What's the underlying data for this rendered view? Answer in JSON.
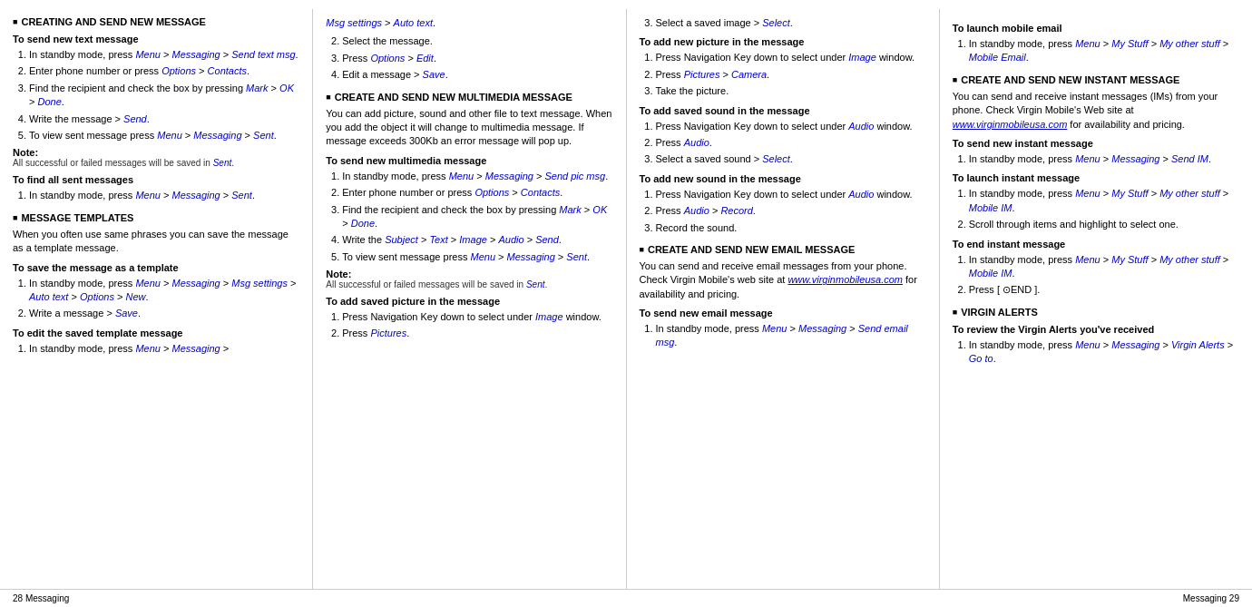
{
  "footer": {
    "left": "28   Messaging",
    "right": "Messaging   29"
  },
  "columns": [
    {
      "id": "col1",
      "sections": [
        {
          "type": "section",
          "title": "CREATING AND SEND NEW MESSAGE",
          "subsections": [
            {
              "type": "subsection",
              "title": "To send new text message",
              "items": [
                {
                  "num": 1,
                  "text": "In standby mode, press ",
                  "links": [
                    "Menu",
                    "Messaging",
                    "Send text msg"
                  ],
                  "separators": [
                    " > ",
                    " > "
                  ]
                },
                {
                  "num": 2,
                  "text": "Enter phone number or press ",
                  "links": [
                    "Options",
                    "Contacts"
                  ],
                  "separators": [
                    " > "
                  ]
                },
                {
                  "num": 3,
                  "text": "Find the recipient and check the box by pressing ",
                  "links": [
                    "Mark",
                    "OK",
                    "Done"
                  ],
                  "separators": [
                    " > ",
                    " > "
                  ]
                },
                {
                  "num": 4,
                  "text": "Write the message > ",
                  "links": [
                    "Send"
                  ]
                },
                {
                  "num": 5,
                  "text": "To view sent message press ",
                  "links": [
                    "Menu",
                    "Messaging",
                    "Sent"
                  ],
                  "separators": [
                    " > ",
                    " > "
                  ]
                }
              ],
              "note": {
                "label": "Note:",
                "text": "All successful or failed messages will be saved in Sent."
              }
            },
            {
              "type": "subsection",
              "title": "To find all sent messages",
              "items": [
                {
                  "num": 1,
                  "text": "In standby mode, press ",
                  "links": [
                    "Menu",
                    "Messaging",
                    "Sent"
                  ],
                  "separators": [
                    " > ",
                    " > "
                  ]
                }
              ]
            }
          ]
        },
        {
          "type": "section",
          "title": "MESSAGE TEMPLATES",
          "desc": "When you often use same phrases you can save the message as a template message.",
          "subsections": [
            {
              "type": "subsection",
              "title": "To save the message as a template",
              "items": [
                {
                  "num": 1,
                  "text": "In standby mode, press ",
                  "links": [
                    "Menu",
                    "Messaging",
                    "Msg settings",
                    "Auto text",
                    "Options",
                    "New"
                  ],
                  "separators": [
                    " > ",
                    " > ",
                    " > ",
                    " > ",
                    " > "
                  ]
                },
                {
                  "num": 2,
                  "text": "Write a message > ",
                  "links": [
                    "Save"
                  ]
                }
              ]
            },
            {
              "type": "subsection",
              "title": "To edit the saved template message",
              "items": [
                {
                  "num": 1,
                  "text": "In standby mode, press ",
                  "links": [
                    "Menu",
                    "Messaging"
                  ],
                  "separators": [
                    " > "
                  ],
                  "suffix": " > "
                }
              ]
            }
          ]
        }
      ]
    },
    {
      "id": "col2",
      "sections": [
        {
          "type": "continuation",
          "prefix_links": [
            "Msg settings",
            "Auto text"
          ],
          "prefix_separators": [
            " > "
          ],
          "subsections": [
            {
              "items_plain": [
                {
                  "num": 2,
                  "text": "Select the message."
                },
                {
                  "num": 3,
                  "text": "Press ",
                  "links": [
                    "Options",
                    "Edit"
                  ],
                  "separators": [
                    " > "
                  ]
                },
                {
                  "num": 4,
                  "text": "Edit a message > ",
                  "links": [
                    "Save"
                  ]
                }
              ]
            }
          ]
        },
        {
          "type": "section",
          "title": "CREATE AND SEND NEW MULTIMEDIA MESSAGE",
          "desc": "You can add picture, sound and other file to text message. When you add the object it will change to multimedia message. If message exceeds 300Kb an error message will pop up.",
          "subsections": [
            {
              "type": "subsection",
              "title": "To send new multimedia message",
              "items": [
                {
                  "num": 1,
                  "text": "In standby mode, press ",
                  "links": [
                    "Menu",
                    "Messaging",
                    "Send pic msg"
                  ],
                  "separators": [
                    " > ",
                    " > "
                  ]
                },
                {
                  "num": 2,
                  "text": "Enter phone number or press ",
                  "links": [
                    "Options",
                    "Contacts"
                  ],
                  "separators": [
                    " > "
                  ]
                },
                {
                  "num": 3,
                  "text": "Find the recipient and check the box by pressing ",
                  "links": [
                    "Mark",
                    "OK",
                    "Done"
                  ],
                  "separators": [
                    " > ",
                    " > "
                  ]
                },
                {
                  "num": 4,
                  "text": "Write the ",
                  "links": [
                    "Subject",
                    "Text",
                    "Image",
                    "Audio",
                    "Send"
                  ],
                  "separators": [
                    " > ",
                    " > ",
                    " > ",
                    " > "
                  ]
                },
                {
                  "num": 5,
                  "text": "To view sent message press ",
                  "links": [
                    "Menu",
                    "Messaging",
                    "Sent"
                  ],
                  "separators": [
                    " > ",
                    " > "
                  ]
                }
              ],
              "note": {
                "label": "Note:",
                "text": "All successful or failed messages will be saved in Sent."
              }
            },
            {
              "type": "subsection",
              "title": "To add saved picture in the message",
              "items": [
                {
                  "num": 1,
                  "text": "Press Navigation Key down to select under ",
                  "links": [
                    "Image"
                  ],
                  "suffix": " window."
                },
                {
                  "num": 2,
                  "text": "Press ",
                  "links": [
                    "Pictures"
                  ]
                }
              ]
            }
          ]
        }
      ]
    },
    {
      "id": "col3",
      "sections": [
        {
          "type": "continuation2",
          "items_plain": [
            {
              "num": 3,
              "text": "Select a saved image > ",
              "links": [
                "Select"
              ]
            }
          ],
          "subsections": [
            {
              "type": "subsection",
              "title": "To add new picture in the message",
              "items": [
                {
                  "num": 1,
                  "text": "Press Navigation Key down to select under ",
                  "links": [
                    "Image"
                  ],
                  "suffix": " window."
                },
                {
                  "num": 2,
                  "text": "Press ",
                  "links": [
                    "Pictures"
                  ],
                  "suffix": " > ",
                  "links2": [
                    "Camera"
                  ]
                },
                {
                  "num": 3,
                  "text": "Take the picture."
                }
              ]
            },
            {
              "type": "subsection",
              "title": "To add saved sound in the message",
              "items": [
                {
                  "num": 1,
                  "text": "Press Navigation Key down to select under ",
                  "links": [
                    "Audio"
                  ],
                  "suffix": " window."
                },
                {
                  "num": 2,
                  "text": "Press ",
                  "links": [
                    "Audio"
                  ]
                },
                {
                  "num": 3,
                  "text": "Select a saved sound > ",
                  "links": [
                    "Select"
                  ]
                }
              ]
            },
            {
              "type": "subsection",
              "title": "To add new sound in the message",
              "items": [
                {
                  "num": 1,
                  "text": "Press Navigation Key down to select under ",
                  "links": [
                    "Audio"
                  ],
                  "suffix": " window."
                },
                {
                  "num": 2,
                  "text": "Press ",
                  "links": [
                    "Audio",
                    "Record"
                  ],
                  "separators": [
                    " > "
                  ]
                },
                {
                  "num": 3,
                  "text": "Record the sound."
                }
              ]
            }
          ]
        },
        {
          "type": "section",
          "title": "CREATE AND SEND NEW EMAIL MESSAGE",
          "desc": "You can send and receive email messages from your phone. Check Virgin Mobile's web site at www.virginmobileusa.com for availability and pricing.",
          "subsections": [
            {
              "type": "subsection",
              "title": "To send new email message",
              "items": [
                {
                  "num": 1,
                  "text": "In standby mode, press ",
                  "links": [
                    "Menu",
                    "Messaging",
                    "Send email msg"
                  ],
                  "separators": [
                    " > ",
                    " > "
                  ]
                }
              ]
            }
          ]
        }
      ]
    },
    {
      "id": "col4",
      "sections": [
        {
          "type": "subsection-standalone",
          "title": "To launch mobile email",
          "items": [
            {
              "num": 1,
              "text": "In standby mode, press ",
              "links": [
                "Menu",
                "My Stuff",
                "My other stuff",
                "Mobile Email"
              ],
              "separators": [
                " > ",
                " > ",
                " > "
              ]
            }
          ]
        },
        {
          "type": "section",
          "title": "CREATE AND SEND NEW INSTANT MESSAGE",
          "desc": "You can send and receive instant messages (IMs) from your phone. Check Virgin Mobile's Web site at www.virginmobileusa.com for availability and pricing.",
          "subsections": [
            {
              "type": "subsection",
              "title": "To send new instant message",
              "items": [
                {
                  "num": 1,
                  "text": "In standby mode, press ",
                  "links": [
                    "Menu",
                    "Messaging",
                    "Send IM"
                  ],
                  "separators": [
                    " > ",
                    " > "
                  ]
                }
              ]
            },
            {
              "type": "subsection",
              "title": "To launch instant message",
              "items": [
                {
                  "num": 1,
                  "text": "In standby mode, press ",
                  "links": [
                    "Menu",
                    "My Stuff",
                    "My other stuff",
                    "Mobile IM"
                  ],
                  "separators": [
                    " > ",
                    " > ",
                    " > "
                  ]
                },
                {
                  "num": 2,
                  "text": "Scroll through items and highlight to select one."
                }
              ]
            },
            {
              "type": "subsection",
              "title": "To end instant message",
              "items": [
                {
                  "num": 1,
                  "text": "In standby mode, press ",
                  "links": [
                    "Menu",
                    "My Stuff",
                    "My other stuff",
                    "Mobile IM"
                  ],
                  "separators": [
                    " > ",
                    " > ",
                    " > "
                  ]
                },
                {
                  "num": 2,
                  "text": "Press [ ⊙END ]."
                }
              ]
            }
          ]
        },
        {
          "type": "section",
          "title": "VIRGIN ALERTS",
          "subsections": [
            {
              "type": "subsection",
              "title": "To review the Virgin Alerts you've received",
              "items": [
                {
                  "num": 1,
                  "text": "In standby mode, press ",
                  "links": [
                    "Menu",
                    "Messaging",
                    "Virgin Alerts",
                    "Go to"
                  ],
                  "separators": [
                    " > ",
                    " > ",
                    " > "
                  ]
                }
              ]
            }
          ]
        }
      ]
    }
  ]
}
